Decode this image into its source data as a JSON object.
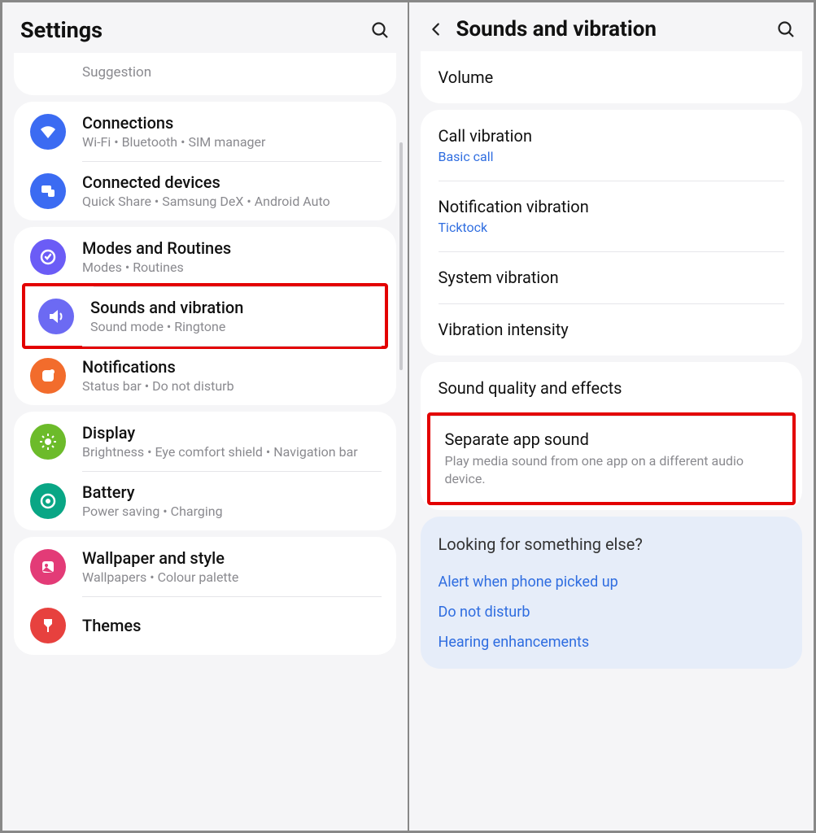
{
  "left": {
    "title": "Settings",
    "truncated_top": "Suggestion",
    "groups": [
      {
        "items": [
          {
            "icon": "wifi-icon",
            "bg": "bg-blue",
            "title": "Connections",
            "sub": "Wi-Fi  •  Bluetooth  •  SIM manager"
          },
          {
            "icon": "devices-icon",
            "bg": "bg-blue",
            "title": "Connected devices",
            "sub": "Quick Share  •  Samsung DeX  •  Android Auto"
          }
        ]
      },
      {
        "items": [
          {
            "icon": "routines-icon",
            "bg": "bg-violet",
            "title": "Modes and Routines",
            "sub": "Modes  •  Routines"
          },
          {
            "icon": "sound-icon",
            "bg": "bg-violet2",
            "title": "Sounds and vibration",
            "sub": "Sound mode  •  Ringtone",
            "highlight": true
          },
          {
            "icon": "notifications-icon",
            "bg": "bg-orange",
            "title": "Notifications",
            "sub": "Status bar  •  Do not disturb"
          }
        ]
      },
      {
        "items": [
          {
            "icon": "display-icon",
            "bg": "bg-green",
            "title": "Display",
            "sub": "Brightness  •  Eye comfort shield  •  Navigation bar"
          },
          {
            "icon": "battery-icon",
            "bg": "bg-teal",
            "title": "Battery",
            "sub": "Power saving  •  Charging"
          }
        ]
      },
      {
        "items": [
          {
            "icon": "wallpaper-icon",
            "bg": "bg-pink",
            "title": "Wallpaper and style",
            "sub": "Wallpapers  •  Colour palette"
          },
          {
            "icon": "themes-icon",
            "bg": "bg-red",
            "title": "Themes",
            "sub": ""
          }
        ]
      }
    ]
  },
  "right": {
    "title": "Sounds and vibration",
    "sections": [
      {
        "rows": [
          {
            "title": "Volume"
          }
        ]
      },
      {
        "rows": [
          {
            "title": "Call vibration",
            "sub": "Basic call",
            "sub_style": "blue"
          },
          {
            "title": "Notification vibration",
            "sub": "Ticktock",
            "sub_style": "blue"
          },
          {
            "title": "System vibration"
          },
          {
            "title": "Vibration intensity"
          }
        ]
      },
      {
        "rows": [
          {
            "title": "Sound quality and effects"
          },
          {
            "title": "Separate app sound",
            "sub": "Play media sound from one app on a different audio device.",
            "sub_style": "gray",
            "highlight": true
          }
        ]
      }
    ],
    "suggest": {
      "heading": "Looking for something else?",
      "links": [
        "Alert when phone picked up",
        "Do not disturb",
        "Hearing enhancements"
      ]
    }
  }
}
